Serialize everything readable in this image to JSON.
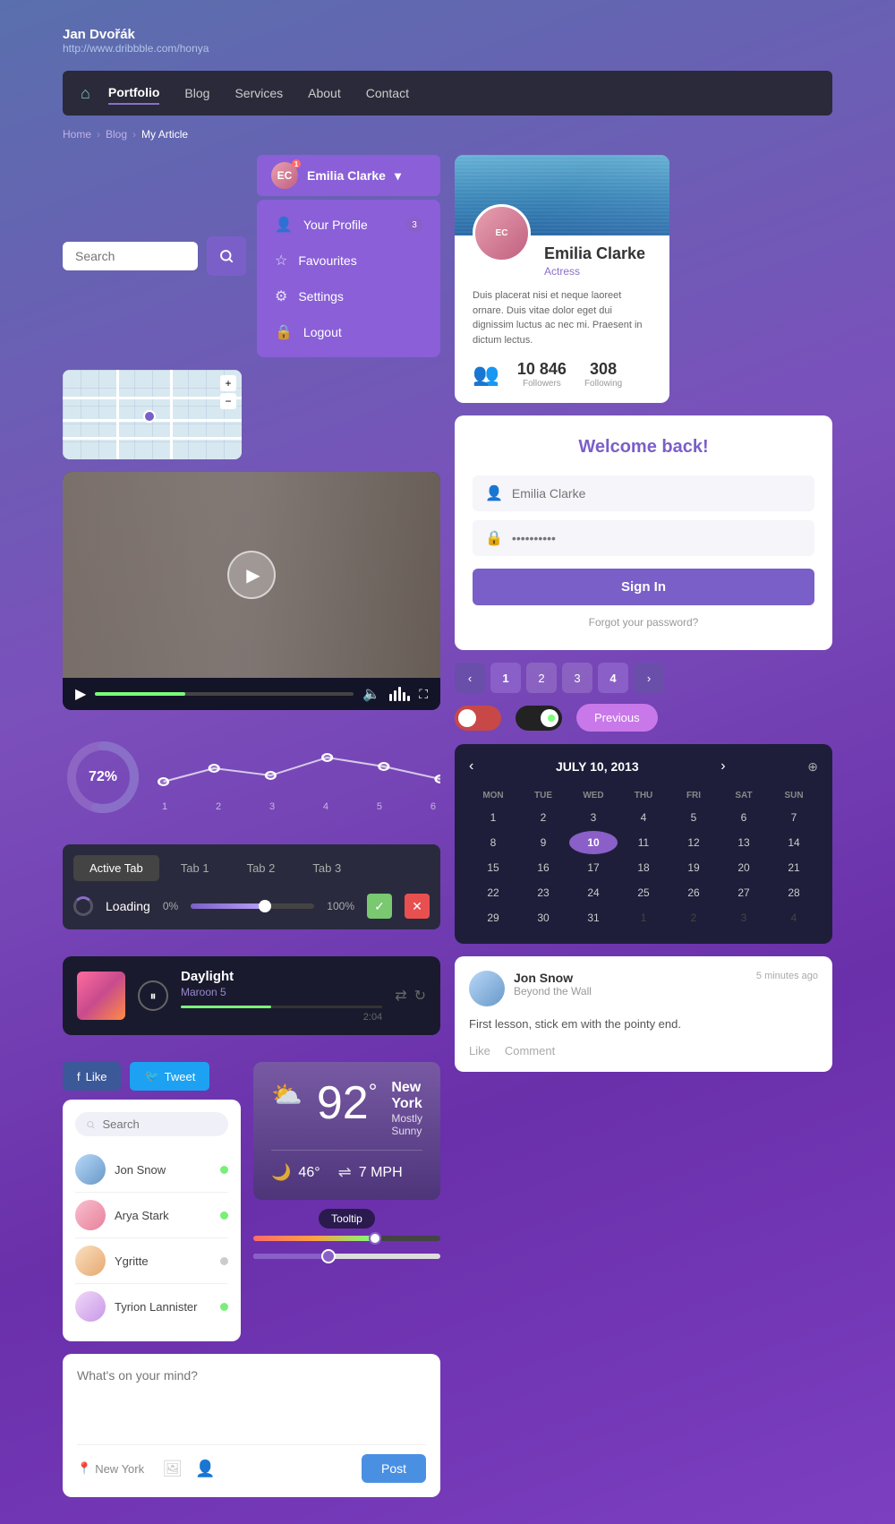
{
  "author": {
    "name": "Jan Dvořák",
    "url": "http://www.dribbble.com/honya"
  },
  "nav": {
    "home_icon": "⌂",
    "items": [
      {
        "label": "Portfolio",
        "active": true
      },
      {
        "label": "Blog",
        "active": false
      },
      {
        "label": "Services",
        "active": false
      },
      {
        "label": "About",
        "active": false
      },
      {
        "label": "Contact",
        "active": false
      }
    ]
  },
  "breadcrumb": {
    "home": "Home",
    "blog": "Blog",
    "current": "My Article"
  },
  "search": {
    "placeholder": "Search"
  },
  "user_dropdown": {
    "name": "Emilia Clarke",
    "badge": "1",
    "menu": [
      {
        "label": "Your Profile",
        "icon": "👤",
        "badge": "3"
      },
      {
        "label": "Favourites",
        "icon": "☆"
      },
      {
        "label": "Settings",
        "icon": "⚙"
      },
      {
        "label": "Logout",
        "icon": "🔒"
      }
    ]
  },
  "profile_card": {
    "name": "Emilia Clarke",
    "role": "Actress",
    "bio": "Duis placerat nisi et neque laoreet ornare. Duis vitae dolor eget dui dignissim luctus ac nec mi. Praesent in dictum lectus.",
    "followers": "10 846",
    "followers_label": "Followers",
    "following": "308",
    "following_label": "Following"
  },
  "donut": {
    "percent": "72%",
    "value": 72
  },
  "line_chart": {
    "labels": [
      "1",
      "2",
      "3",
      "4",
      "5",
      "6"
    ]
  },
  "tabs": {
    "items": [
      {
        "label": "Active Tab"
      },
      {
        "label": "Tab 1"
      },
      {
        "label": "Tab 2"
      },
      {
        "label": "Tab 3"
      }
    ],
    "loading_text": "Loading",
    "percent_min": "0%",
    "percent_max": "100%"
  },
  "music": {
    "title": "Daylight",
    "artist": "Maroon 5",
    "time": "2:04"
  },
  "social": {
    "like_label": "Like",
    "tweet_label": "Tweet"
  },
  "user_list": {
    "search_placeholder": "Search",
    "users": [
      {
        "name": "Jon Snow",
        "status": "online"
      },
      {
        "name": "Arya Stark",
        "status": "online"
      },
      {
        "name": "Ygritte",
        "status": "offline"
      },
      {
        "name": "Tyrion Lannister",
        "status": "online"
      }
    ]
  },
  "weather": {
    "temp": "92",
    "deg": "°",
    "city": "New York",
    "condition": "Mostly Sunny",
    "low_temp": "46°",
    "wind": "7 MPH"
  },
  "tooltip_slider": {
    "label": "Tooltip"
  },
  "calendar": {
    "month": "JULY 10, 2013",
    "days_header": [
      "MON",
      "TUE",
      "WED",
      "THU",
      "FRI",
      "SAT",
      "SUN"
    ],
    "today": 10,
    "days": [
      1,
      2,
      3,
      4,
      5,
      6,
      7,
      8,
      9,
      10,
      11,
      12,
      13,
      14,
      15,
      16,
      17,
      18,
      19,
      20,
      21,
      22,
      23,
      24,
      25,
      26,
      27,
      28,
      29,
      30,
      31
    ],
    "trailing": [
      1,
      2,
      3,
      4
    ]
  },
  "pagination": {
    "pages": [
      "1",
      "2",
      "3",
      "4"
    ],
    "active": "1",
    "active2": "4"
  },
  "welcome": {
    "title": "Welcome back!",
    "username_placeholder": "Emilia Clarke",
    "password_placeholder": "••••••••••",
    "signin_label": "Sign In",
    "forgot_label": "Forgot your password?"
  },
  "post": {
    "placeholder": "What's on your mind?",
    "location": "New York",
    "button_label": "Post"
  },
  "activity": {
    "username": "Jon Snow",
    "sub": "Beyond the Wall",
    "time": "5 minutes ago",
    "text": "First lesson, stick em with the pointy end.",
    "like_label": "Like",
    "comment_label": "Comment"
  }
}
